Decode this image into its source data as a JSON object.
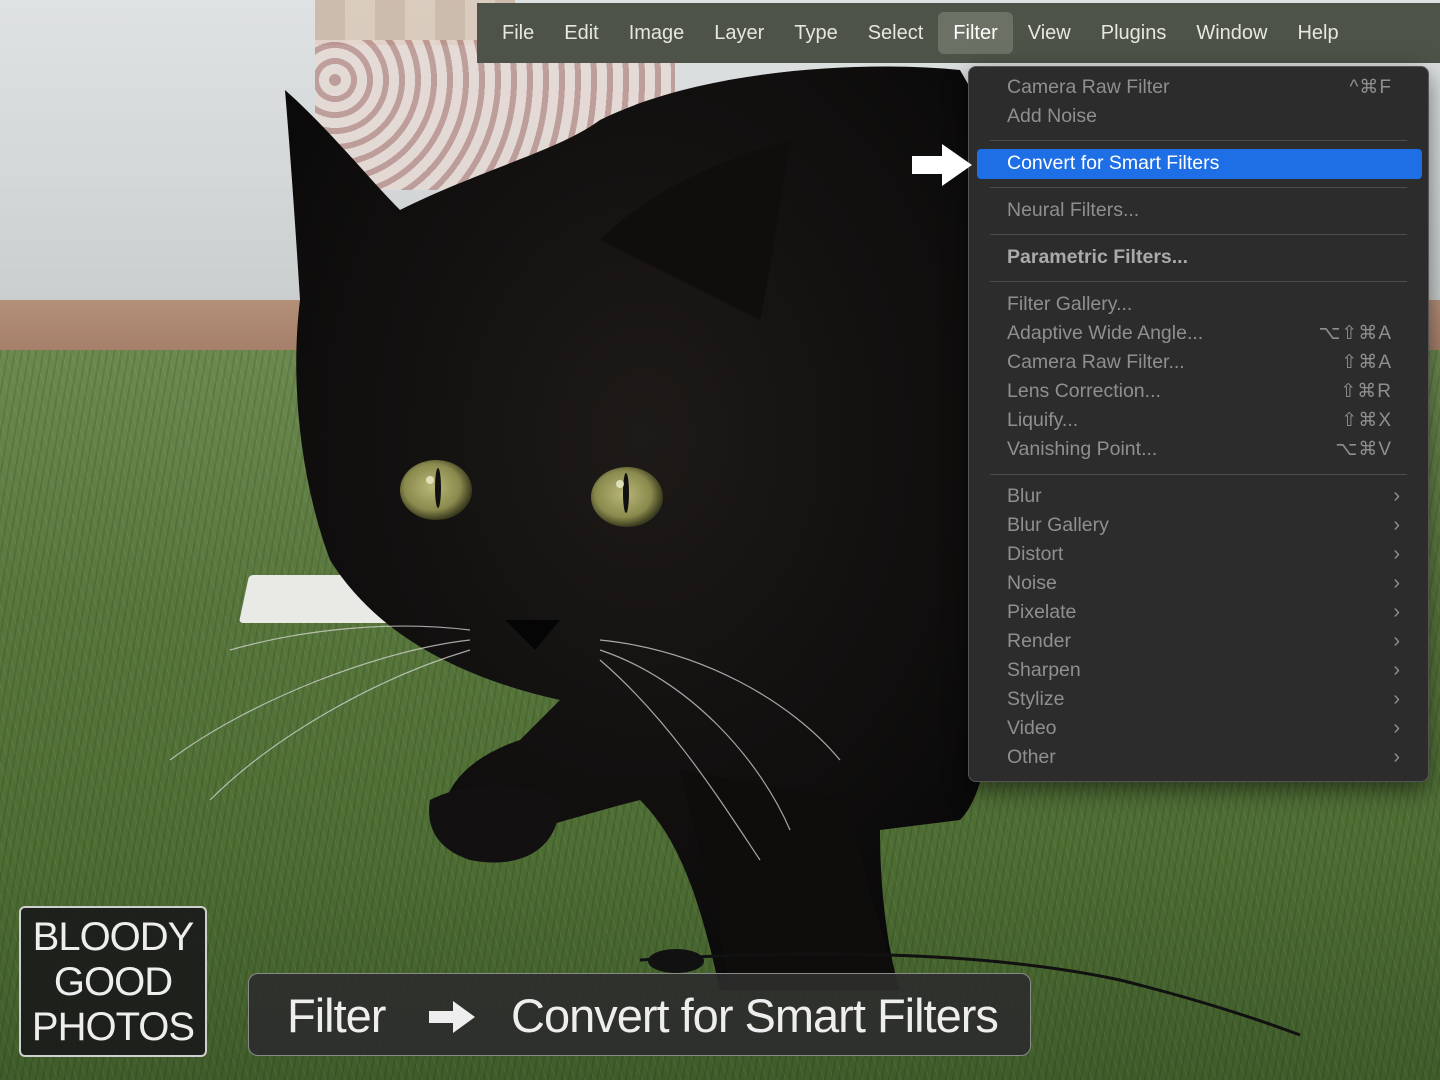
{
  "menubar": {
    "items": [
      {
        "label": "File"
      },
      {
        "label": "Edit"
      },
      {
        "label": "Image"
      },
      {
        "label": "Layer"
      },
      {
        "label": "Type"
      },
      {
        "label": "Select"
      },
      {
        "label": "Filter",
        "active": true
      },
      {
        "label": "View"
      },
      {
        "label": "Plugins"
      },
      {
        "label": "Window"
      },
      {
        "label": "Help"
      }
    ]
  },
  "filter_menu": {
    "items": [
      {
        "label": "Camera Raw Filter",
        "shortcut": "^⌘F"
      },
      {
        "label": "Add Noise",
        "shortcut": ""
      },
      {
        "label": "Convert for Smart Filters",
        "shortcut": "",
        "highlighted": true
      },
      {
        "label": "Neural Filters...",
        "shortcut": ""
      },
      {
        "label": "Parametric Filters...",
        "shortcut": ""
      },
      {
        "label": "Filter Gallery...",
        "shortcut": ""
      },
      {
        "label": "Adaptive Wide Angle...",
        "shortcut": "⌥⇧⌘A"
      },
      {
        "label": "Camera Raw Filter...",
        "shortcut": "⇧⌘A"
      },
      {
        "label": "Lens Correction...",
        "shortcut": "⇧⌘R"
      },
      {
        "label": "Liquify...",
        "shortcut": "⇧⌘X"
      },
      {
        "label": "Vanishing Point...",
        "shortcut": "⌥⌘V"
      },
      {
        "label": "Blur",
        "submenu": "›"
      },
      {
        "label": "Blur Gallery",
        "submenu": "›"
      },
      {
        "label": "Distort",
        "submenu": "›"
      },
      {
        "label": "Noise",
        "submenu": "›"
      },
      {
        "label": "Pixelate",
        "submenu": "›"
      },
      {
        "label": "Render",
        "submenu": "›"
      },
      {
        "label": "Sharpen",
        "submenu": "›"
      },
      {
        "label": "Stylize",
        "submenu": "›"
      },
      {
        "label": "Video",
        "submenu": "›"
      },
      {
        "label": "Other",
        "submenu": "›"
      }
    ]
  },
  "caption": {
    "left": "Filter",
    "right": "Convert for Smart Filters"
  },
  "logo": {
    "line1": "BLOODY",
    "line2": "GOOD",
    "line3": "PHOTOS"
  },
  "colors": {
    "highlight": "#1e6ee5",
    "menubar": "#4d5348",
    "menu_bg": "#2c2c2c"
  },
  "icons": {
    "pointer": "right-arrow-icon",
    "caption_arrow": "right-arrow-icon",
    "submenu": "chevron-right-icon"
  }
}
